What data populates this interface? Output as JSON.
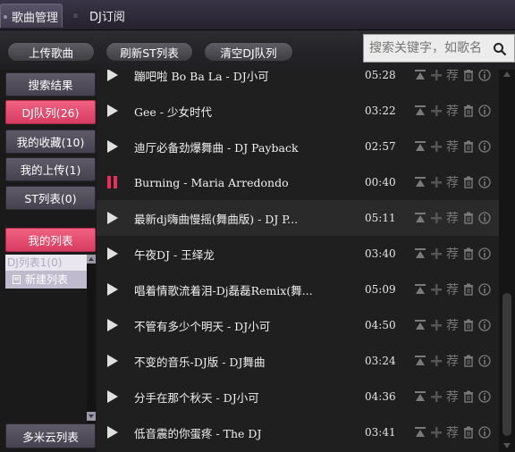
{
  "tabs": [
    {
      "label": "歌曲管理",
      "active": true
    },
    {
      "label": "DJ订阅",
      "active": false
    }
  ],
  "toolbar": {
    "upload_label": "上传歌曲",
    "refresh_label": "刷新ST列表",
    "clear_label": "清空DJ队列"
  },
  "search": {
    "placeholder": "搜索关键字，如歌名",
    "value": ""
  },
  "sidebar": {
    "items": [
      {
        "label": "搜索结果"
      },
      {
        "label": "DJ队列(26)"
      },
      {
        "label": "我的收藏(10)"
      },
      {
        "label": "我的上传(1)"
      },
      {
        "label": "ST列表(0)"
      },
      {
        "label": "我的列表"
      }
    ],
    "sub_items": [
      {
        "label": "DJ列表1(0)"
      },
      {
        "label": "新建列表"
      }
    ],
    "cloud_label": "多米云列表"
  },
  "songs": [
    {
      "title": "蹦吧啦 Bo Ba La - DJ小可",
      "duration": "05:28",
      "state": "play"
    },
    {
      "title": "Gee - 少女时代",
      "duration": "03:22",
      "state": "play"
    },
    {
      "title": "迪厅必备劲爆舞曲  - DJ Payback",
      "duration": "02:57",
      "state": "play"
    },
    {
      "title": "Burning - Maria Arredondo",
      "duration": "00:40",
      "state": "pause"
    },
    {
      "title": "最新dj嗨曲慢摇(舞曲版) - DJ P...",
      "duration": "05:11",
      "state": "play"
    },
    {
      "title": "午夜DJ - 王绎龙",
      "duration": "03:40",
      "state": "play"
    },
    {
      "title": "唱着情歌流着泪-Dj磊磊Remix(舞...",
      "duration": "05:09",
      "state": "play"
    },
    {
      "title": "不管有多少个明天 - DJ小可",
      "duration": "04:50",
      "state": "play"
    },
    {
      "title": "不变的音乐-DJ版 - DJ舞曲",
      "duration": "03:24",
      "state": "play"
    },
    {
      "title": "分手在那个秋天 - DJ小可",
      "duration": "04:36",
      "state": "play"
    },
    {
      "title": "低音震的你蛋疼 - The DJ",
      "duration": "03:41",
      "state": "play"
    }
  ],
  "row_action_recommend": "荐",
  "colors": {
    "accent": "#e7315a",
    "tab_bg": "#3a3547"
  }
}
